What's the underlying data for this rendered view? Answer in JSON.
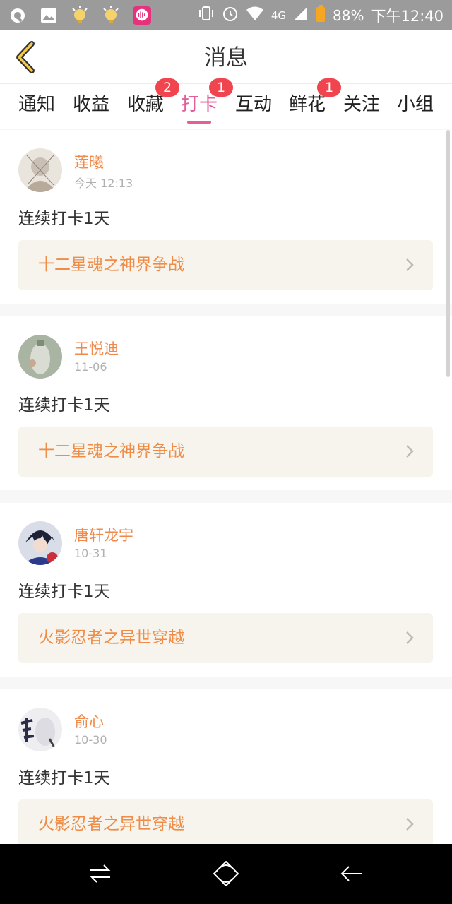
{
  "status_bar": {
    "battery": "88%",
    "network": "4G",
    "time": "下午12:40",
    "icons": [
      "browser-icon",
      "gallery-icon",
      "lightbulb-icon",
      "lightbulb-icon",
      "chat-app-icon",
      "vibrate-icon",
      "alarm-icon",
      "wifi-icon",
      "signal-icon",
      "battery-icon"
    ]
  },
  "header": {
    "title": "消息",
    "back_icon": "chevron-left-icon"
  },
  "tabs": [
    {
      "label": "通知",
      "badge": "",
      "active": false
    },
    {
      "label": "收益",
      "badge": "",
      "active": false
    },
    {
      "label": "收藏",
      "badge": "2",
      "active": false
    },
    {
      "label": "打卡",
      "badge": "1",
      "active": true
    },
    {
      "label": "互动",
      "badge": "",
      "active": false
    },
    {
      "label": "鲜花",
      "badge": "1",
      "active": false
    },
    {
      "label": "关注",
      "badge": "",
      "active": false
    },
    {
      "label": "小组",
      "badge": "",
      "active": false
    }
  ],
  "messages": [
    {
      "name": "莲曦",
      "date": "今天 12:13",
      "text": "连续打卡1天",
      "book": "十二星魂之神界争战"
    },
    {
      "name": "王悦迪",
      "date": "11-06",
      "text": "连续打卡1天",
      "book": "十二星魂之神界争战"
    },
    {
      "name": "唐轩龙宇",
      "date": "10-31",
      "text": "连续打卡1天",
      "book": "火影忍者之异世穿越"
    },
    {
      "name": "俞心",
      "date": "10-30",
      "text": "连续打卡1天",
      "book": "火影忍者之异世穿越"
    }
  ],
  "colors": {
    "accent": "#e25f99",
    "name_orange": "#f08a4b",
    "book_orange": "#ee8c48",
    "badge_red": "#f0454e",
    "book_bg": "#f6f4ec"
  },
  "nav_bar": {
    "icons": [
      "switch-icon",
      "home-icon",
      "back-icon"
    ]
  }
}
